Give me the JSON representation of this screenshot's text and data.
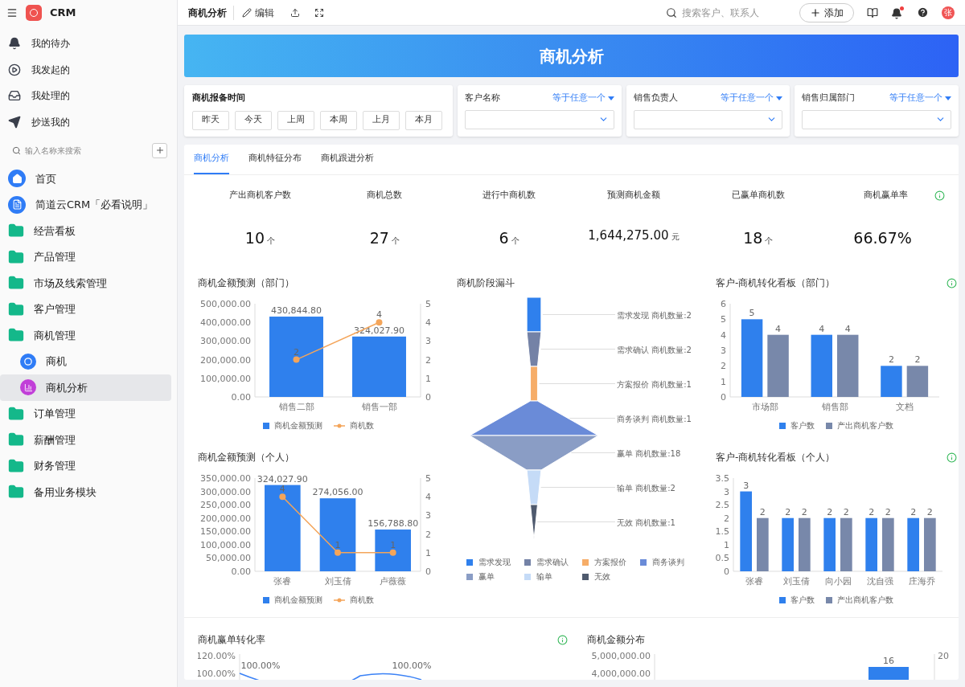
{
  "app": {
    "name": "CRM"
  },
  "sidebar": {
    "quick_items": [
      {
        "label": "我的待办",
        "kind": "bell"
      },
      {
        "label": "我发起的",
        "kind": "play"
      },
      {
        "label": "我处理的",
        "kind": "inbox"
      },
      {
        "label": "抄送我的",
        "kind": "send"
      }
    ],
    "search": {
      "placeholder": "输入名称来搜索"
    },
    "items": [
      {
        "label": "首页",
        "kind": "home",
        "selected": false
      },
      {
        "label": "简道云CRM「必看说明」",
        "kind": "doc",
        "selected": false
      },
      {
        "label": "经营看板",
        "kind": "folder",
        "selected": false
      },
      {
        "label": "产品管理",
        "kind": "folder",
        "selected": false
      },
      {
        "label": "市场及线索管理",
        "kind": "folder",
        "selected": false
      },
      {
        "label": "客户管理",
        "kind": "folder",
        "selected": false
      },
      {
        "label": "商机管理",
        "kind": "folder",
        "selected": false,
        "children": [
          {
            "label": "商机",
            "kind": "form",
            "selected": false
          },
          {
            "label": "商机分析",
            "kind": "report",
            "selected": true
          }
        ]
      },
      {
        "label": "订单管理",
        "kind": "folder",
        "selected": false
      },
      {
        "label": "薪酬管理",
        "kind": "folder",
        "selected": false
      },
      {
        "label": "财务管理",
        "kind": "folder",
        "selected": false
      },
      {
        "label": "备用业务模块",
        "kind": "folder",
        "selected": false
      }
    ]
  },
  "toolbar": {
    "title": "商机分析",
    "edit_label": "编辑",
    "search_placeholder": "搜索客户、联系人",
    "add_label": "添加",
    "has_unread": true,
    "avatar": "张"
  },
  "banner": {
    "title": "商机分析"
  },
  "date_filter": {
    "label": "商机报备时间",
    "buttons": [
      {
        "label": "昨天",
        "selected": false
      },
      {
        "label": "今天",
        "selected": false
      },
      {
        "label": "上周",
        "selected": false
      },
      {
        "label": "本周",
        "selected": false
      },
      {
        "label": "上月",
        "selected": false
      },
      {
        "label": "本月",
        "selected": false
      }
    ]
  },
  "filters": [
    {
      "label": "客户名称",
      "operator": "等于任意一个"
    },
    {
      "label": "销售负责人",
      "operator": "等于任意一个"
    },
    {
      "label": "销售归属部门",
      "operator": "等于任意一个"
    }
  ],
  "tabs": [
    {
      "label": "商机分析",
      "selected": true
    },
    {
      "label": "商机特征分布",
      "selected": false
    },
    {
      "label": "商机跟进分析",
      "selected": false
    }
  ],
  "kpis": [
    {
      "label": "产出商机客户数",
      "value": "10",
      "unit": "个",
      "info": false
    },
    {
      "label": "商机总数",
      "value": "27",
      "unit": "个",
      "info": false
    },
    {
      "label": "进行中商机数",
      "value": "6",
      "unit": "个",
      "info": false
    },
    {
      "label": "预测商机金额",
      "value": "1,644,275.00",
      "unit": "元",
      "info": false
    },
    {
      "label": "已赢单商机数",
      "value": "18",
      "unit": "个",
      "info": false
    },
    {
      "label": "商机赢单率",
      "value": "66.67%",
      "info": true
    }
  ],
  "charts": [
    {
      "title": "商机金额预测（部门）",
      "info": false,
      "chart_data": {
        "type": "bar",
        "categories": [
          "销售二部",
          "销售一部"
        ],
        "ylim": [
          0,
          500000
        ],
        "yticks": [
          {
            "value": 0,
            "label": "0.00"
          },
          {
            "value": 100000,
            "label": "100,000.00"
          },
          {
            "value": 200000,
            "label": "200,000.00"
          },
          {
            "value": 300000,
            "label": "300,000.00"
          },
          {
            "value": 400000,
            "label": "400,000.00"
          },
          {
            "value": 500000,
            "label": "500,000.00"
          }
        ],
        "y2lim": [
          0,
          5
        ],
        "y2ticks": [
          0,
          1,
          2,
          3,
          4,
          5
        ],
        "series": [
          {
            "name": "商机金额预测",
            "type": "bar",
            "color": "#2f80ed",
            "values": [
              430844.8,
              324027.9
            ],
            "value_labels": [
              "430,844.80",
              "324,027.90"
            ]
          },
          {
            "name": "商机数",
            "type": "line",
            "axis": "y2",
            "marker": true,
            "color": "#f4a55a",
            "values": [
              2,
              4
            ],
            "value_labels": [
              "2",
              "4"
            ]
          }
        ]
      }
    },
    {
      "title": "商机阶段漏斗",
      "info": false,
      "chart_data": {
        "type": "other",
        "categories": [
          "需求发现",
          "需求确认",
          "方案报价",
          "商务谈判",
          "赢单",
          "输单",
          "无效"
        ],
        "values": [
          2,
          2,
          1,
          1,
          18,
          2,
          1
        ],
        "value_labels": [
          "需求发现 商机数量:2",
          "需求确认 商机数量:2",
          "方案报价 商机数量:1",
          "商务谈判 商机数量:1",
          "赢单 商机数量:18",
          "输单 商机数量:2",
          "无效 商机数量:1"
        ],
        "colors": [
          "#2f80ed",
          "#7482a6",
          "#f6ad68",
          "#6a8bd8",
          "#8a9dc5",
          "#c5dbf7",
          "#4f5a6e"
        ]
      }
    },
    {
      "title": "客户-商机转化看板（部门）",
      "info": true,
      "chart_data": {
        "type": "bar",
        "categories": [
          "市场部",
          "销售部",
          "文档"
        ],
        "ylim": [
          0,
          6
        ],
        "yticks": [
          0,
          1,
          2,
          3,
          4,
          5,
          6
        ],
        "series": [
          {
            "name": "客户数",
            "type": "bar",
            "color": "#2f80ed",
            "values": [
              5,
              4,
              2
            ],
            "value_labels": [
              "5",
              "4",
              "2"
            ]
          },
          {
            "name": "产出商机客户数",
            "type": "bar",
            "color": "#7888aa",
            "values": [
              4,
              4,
              2
            ],
            "value_labels": [
              "4",
              "4",
              "2"
            ]
          }
        ]
      }
    },
    {
      "title": "商机金额预测（个人）",
      "info": false,
      "chart_data": {
        "type": "bar",
        "categories": [
          "张睿",
          "刘玉倩",
          "卢薇薇"
        ],
        "ylim": [
          0,
          350000
        ],
        "yticks": [
          {
            "value": 0,
            "label": "0.00"
          },
          {
            "value": 50000,
            "label": "50,000.00"
          },
          {
            "value": 100000,
            "label": "100,000.00"
          },
          {
            "value": 150000,
            "label": "150,000.00"
          },
          {
            "value": 200000,
            "label": "200,000.00"
          },
          {
            "value": 250000,
            "label": "250,000.00"
          },
          {
            "value": 300000,
            "label": "300,000.00"
          },
          {
            "value": 350000,
            "label": "350,000.00"
          }
        ],
        "y2lim": [
          0,
          5
        ],
        "y2ticks": [
          0,
          1,
          2,
          3,
          4,
          5
        ],
        "series": [
          {
            "name": "商机金额预测",
            "type": "bar",
            "color": "#2f80ed",
            "values": [
              324027.9,
              274056,
              156788.8
            ],
            "value_labels": [
              "324,027.90",
              "274,056.00",
              "156,788.80"
            ]
          },
          {
            "name": "商机数",
            "type": "line",
            "axis": "y2",
            "marker": true,
            "color": "#f4a55a",
            "values": [
              4,
              1,
              1
            ],
            "value_labels": [
              "4",
              "1",
              "1"
            ]
          }
        ]
      }
    },
    {
      "title": "客户-商机转化看板（个人）",
      "info": true,
      "chart_data": {
        "type": "bar",
        "categories": [
          "张睿",
          "刘玉倩",
          "向小园",
          "沈自强",
          "庄海乔"
        ],
        "ylim": [
          0,
          3.5
        ],
        "yticks": [
          0,
          0.5,
          1,
          1.5,
          2,
          2.5,
          3,
          3.5
        ],
        "series": [
          {
            "name": "客户数",
            "type": "bar",
            "color": "#2f80ed",
            "values": [
              3,
              2,
              2,
              2,
              2
            ],
            "value_labels": [
              "3",
              "2",
              "2",
              "2",
              "2"
            ]
          },
          {
            "name": "产出商机客户数",
            "type": "bar",
            "color": "#7888aa",
            "values": [
              2,
              2,
              2,
              2,
              2
            ],
            "value_labels": [
              "2",
              "2",
              "2",
              "2",
              "2"
            ]
          }
        ]
      }
    }
  ],
  "bottom_charts": [
    {
      "title": "商机赢单转化率",
      "info": true,
      "kind": "line",
      "axis_labels": [
        "120.00%",
        "100.00%"
      ],
      "point_labels": [
        "100.00%",
        "100.00%"
      ]
    },
    {
      "title": "商机金额分布",
      "info": false,
      "kind": "bar",
      "axis_labels": [
        "5,000,000.00",
        "4,000,000.00"
      ],
      "right_axis_labels": [
        "20"
      ],
      "point_labels": [
        "16"
      ]
    }
  ]
}
